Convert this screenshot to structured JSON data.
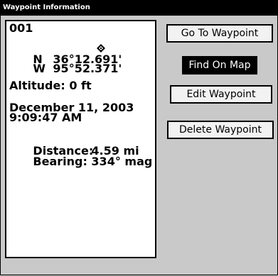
{
  "window": {
    "title": "Waypoint Information"
  },
  "waypoint": {
    "id": "001",
    "lat_hemisphere": "N",
    "lat_value": "36°12.691'",
    "lon_hemisphere": "W",
    "lon_value": "95°52.371'",
    "icon": "waypoint-diamond-icon",
    "altitude": "Altitude: 0 ft",
    "date": "December 11, 2003",
    "time": "9:09:47 AM",
    "distance_label": "Distance:",
    "distance_value": "4.59 mi",
    "bearing_label": "Bearing:",
    "bearing_value": "334° mag"
  },
  "buttons": {
    "goto": "Go To Waypoint",
    "find": "Find On Map",
    "edit": "Edit Waypoint",
    "delete": "Delete Waypoint"
  },
  "colors": {
    "background": "#c9c9c9",
    "titlebar": "#000000",
    "selected_button": "#000000"
  }
}
